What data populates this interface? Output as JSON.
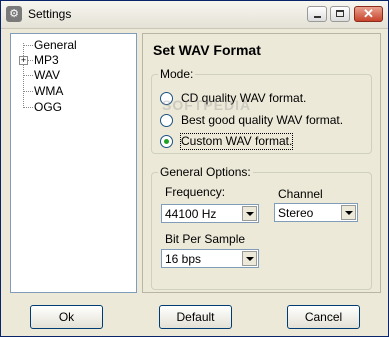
{
  "window": {
    "title": "Settings",
    "icon": "settings-app-icon",
    "controls": {
      "minimize": "minimize-icon",
      "maximize": "maximize-icon",
      "close_glyph": "✕"
    }
  },
  "tree": {
    "items": [
      {
        "label": "General",
        "expandable": false
      },
      {
        "label": "MP3",
        "expandable": true,
        "expander": "+"
      },
      {
        "label": "WAV",
        "expandable": false
      },
      {
        "label": "WMA",
        "expandable": false
      },
      {
        "label": "OGG",
        "expandable": false
      }
    ]
  },
  "panel": {
    "title": "Set WAV Format",
    "watermark": "SOFTPEDIA",
    "mode": {
      "legend": "Mode:",
      "options": [
        {
          "label": "CD quality WAV format.",
          "selected": false
        },
        {
          "label": "Best good quality WAV format.",
          "selected": false
        },
        {
          "label": "Custom WAV format.",
          "selected": true
        }
      ]
    },
    "general": {
      "legend": "General Options:",
      "frequency_label": "Frequency:",
      "frequency_value": "44100 Hz",
      "channel_label": "Channel",
      "channel_value": "Stereo",
      "bps_label": "Bit Per Sample",
      "bps_value": "16 bps"
    }
  },
  "buttons": {
    "ok": "Ok",
    "default": "Default",
    "cancel": "Cancel"
  },
  "colors": {
    "radio_dot": "#21a121",
    "border_blue": "#7f9db9",
    "face": "#ece9d8"
  }
}
